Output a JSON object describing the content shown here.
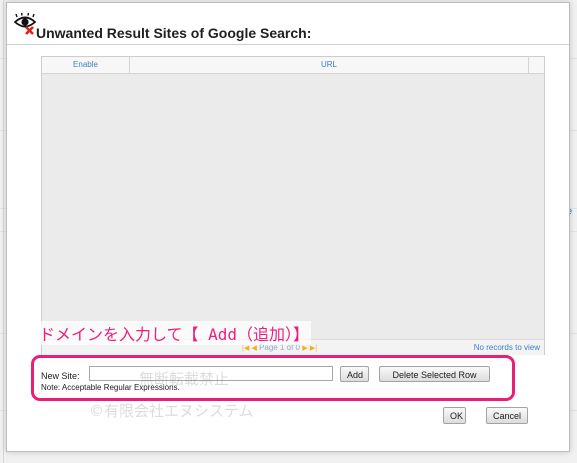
{
  "dialog": {
    "title": "Unwanted Result Sites of Google Search:",
    "title_icon": "eye-blocked-icon"
  },
  "grid": {
    "columns": [
      "Enable",
      "URL"
    ],
    "rows": [],
    "pager_text": "Page 1 of 0",
    "no_records": "No records to view"
  },
  "annotation": {
    "text": "ドメインを入力して【 Add（追加）】",
    "color": "#ec1f7d"
  },
  "form": {
    "new_site_label": "New Site:",
    "new_site_value": "",
    "add_label": "Add",
    "delete_label": "Delete Selected Row",
    "note": "Note: Acceptable Regular Expressions."
  },
  "watermark": {
    "line1": "無断転載禁止",
    "line2": "©有限会社エヌシステム"
  },
  "footer": {
    "ok_label": "OK",
    "cancel_label": "Cancel"
  },
  "background": {
    "right_fragment": "e"
  }
}
